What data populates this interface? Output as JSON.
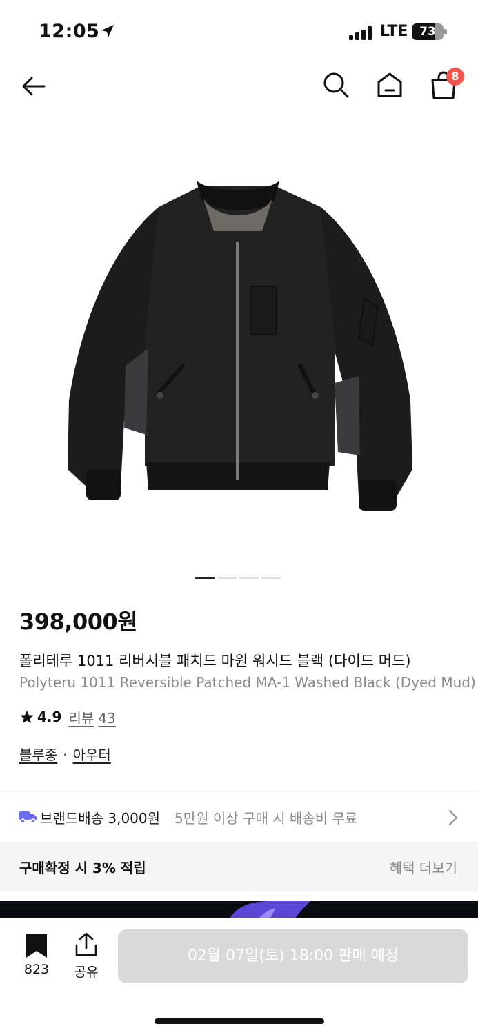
{
  "status_bar": {
    "time": "12:05",
    "network": "LTE",
    "battery": "73",
    "battery_level": 0.73
  },
  "nav": {
    "cart_count": "8"
  },
  "product": {
    "image_pages": 4,
    "active_image": 1,
    "price": "398,000원",
    "title_ko": "폴리테루 1011 리버시블 패치드 마원 워시드 블랙 (다이드 머드)",
    "title_en": "Polyteru 1011 Reversible Patched MA-1 Washed Black (Dyed Mud)",
    "rating": "4.9",
    "review_label": "리뷰",
    "review_count": "43",
    "category_1": "블루종",
    "category_sep": "·",
    "category_2": "아우터"
  },
  "shipping": {
    "label": "브랜드배송 3,000원",
    "note": "5만원 이상 구매 시 배송비 무료"
  },
  "points": {
    "label": "구매확정 시 3% 적립",
    "more": "혜택 더보기"
  },
  "bottom_bar": {
    "bookmark_count": "823",
    "share_label": "공유",
    "buy_button": "02월 07일(토) 18:00 판매 예정"
  },
  "colors": {
    "badge": "#f2554d",
    "truck": "#6b6cf0",
    "disabled_button": "#d9d9d9"
  }
}
